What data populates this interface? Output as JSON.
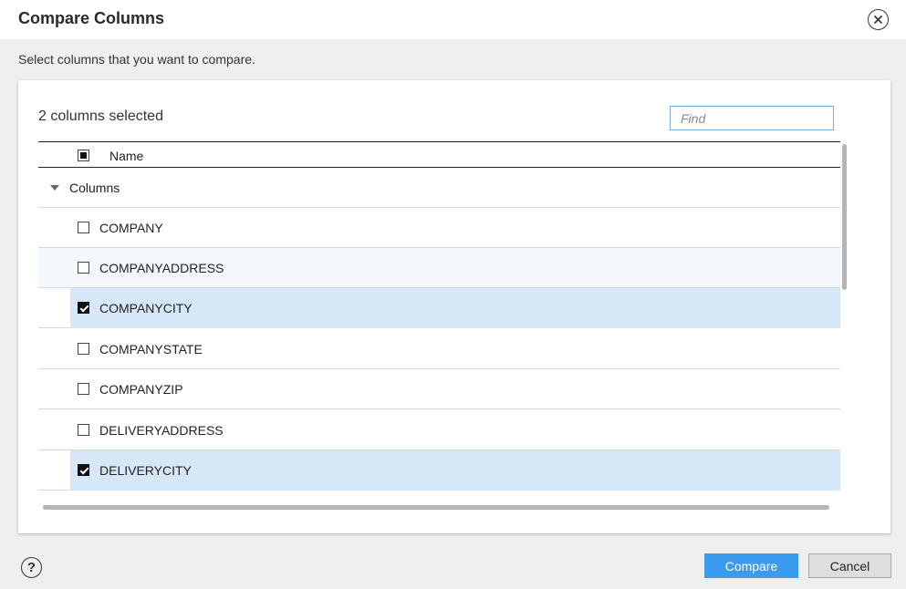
{
  "dialog": {
    "title": "Compare Columns",
    "subtitle": "Select columns that you want to compare."
  },
  "panel": {
    "selected_count_label": "2 columns selected",
    "find_placeholder": "Find",
    "header": {
      "name_label": "Name",
      "select_all_state": "partial"
    },
    "group": {
      "label": "Columns",
      "expanded": true
    },
    "rows": [
      {
        "label": "COMPANY",
        "checked": false
      },
      {
        "label": "COMPANYADDRESS",
        "checked": false
      },
      {
        "label": "COMPANYCITY",
        "checked": true
      },
      {
        "label": "COMPANYSTATE",
        "checked": false
      },
      {
        "label": "COMPANYZIP",
        "checked": false
      },
      {
        "label": "DELIVERYADDRESS",
        "checked": false
      },
      {
        "label": "DELIVERYCITY",
        "checked": true
      }
    ]
  },
  "footer": {
    "compare_label": "Compare",
    "cancel_label": "Cancel",
    "help_icon": "question-circle-icon"
  },
  "colors": {
    "primary": "#3b9bf0",
    "selected_row": "#d6e8f8",
    "hover_row": "#f4f8fc"
  }
}
